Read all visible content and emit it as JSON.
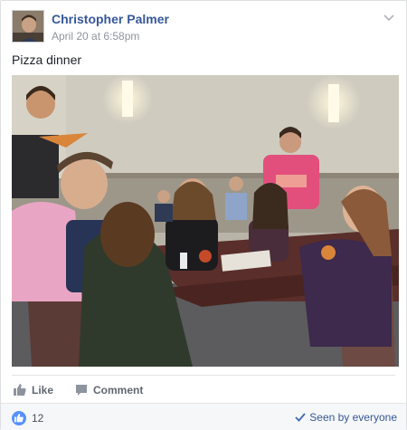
{
  "post": {
    "author": "Christopher Palmer",
    "timestamp": "April 20 at 6:58pm",
    "text": "Pizza dinner"
  },
  "actions": {
    "like_label": "Like",
    "comment_label": "Comment"
  },
  "footer": {
    "reaction_count": "12",
    "seen_label": "Seen by everyone"
  },
  "colors": {
    "link_blue": "#365899",
    "like_blue": "#5890ff",
    "muted_gray": "#90949c"
  },
  "icons": [
    "chevron-down-icon",
    "like-thumb-icon",
    "comment-bubble-icon",
    "like-badge-icon",
    "checkmark-icon"
  ]
}
